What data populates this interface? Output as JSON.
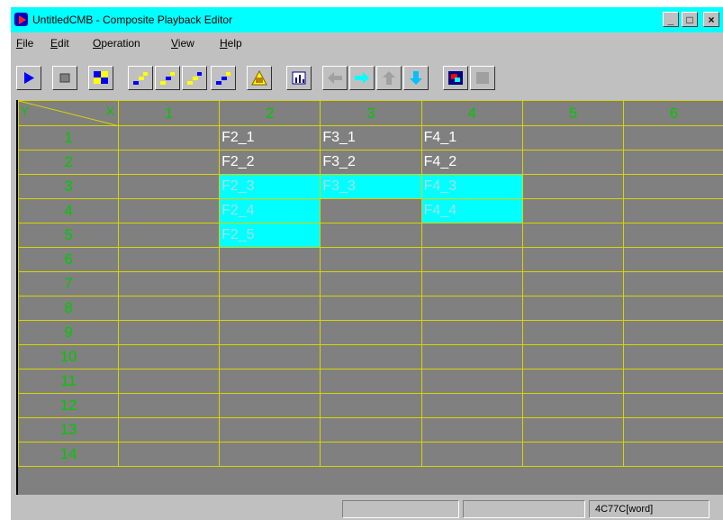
{
  "window": {
    "title": "UntitledCMB - Composite Playback Editor",
    "controls": {
      "minimize": "_",
      "maximize": "□",
      "close": "×"
    }
  },
  "menu": [
    {
      "label": "File",
      "key": "F"
    },
    {
      "label": "Edit",
      "key": "E"
    },
    {
      "label": "Operation",
      "key": "O"
    },
    {
      "label": "View",
      "key": "V"
    },
    {
      "label": "Help",
      "key": "H"
    }
  ],
  "toolbar": {
    "buttons": [
      {
        "name": "play-icon"
      },
      {
        "name": "stop-icon"
      },
      {
        "name": "frames-icon"
      },
      {
        "name": "step-icon-1"
      },
      {
        "name": "step-icon-2"
      },
      {
        "name": "step-icon-3"
      },
      {
        "name": "step-icon-4"
      },
      {
        "name": "warning-icon"
      },
      {
        "name": "chart-icon"
      },
      {
        "name": "arrow-left-icon"
      },
      {
        "name": "arrow-right-icon"
      },
      {
        "name": "arrow-up-icon"
      },
      {
        "name": "arrow-down-icon"
      },
      {
        "name": "color-icon"
      },
      {
        "name": "blank-icon"
      }
    ],
    "colors": {
      "blue": "#0000ff",
      "cyan": "#00ffff",
      "yellow": "#ffff00",
      "navy": "#000080",
      "red": "#ff0000"
    }
  },
  "grid": {
    "corner": {
      "y": "Y",
      "x": "X"
    },
    "columns": [
      "1",
      "2",
      "3",
      "4",
      "5",
      "6"
    ],
    "rows": [
      {
        "label": "1",
        "cells": [
          "",
          "F2_1",
          "F3_1",
          "F4_1",
          "",
          ""
        ],
        "highlight": [
          false,
          false,
          false,
          false,
          false,
          false
        ]
      },
      {
        "label": "2",
        "cells": [
          "",
          "F2_2",
          "F3_2",
          "F4_2",
          "",
          ""
        ],
        "highlight": [
          false,
          false,
          false,
          false,
          false,
          false
        ]
      },
      {
        "label": "3",
        "cells": [
          "",
          "F2_3",
          "F3_3",
          "F4_3",
          "",
          ""
        ],
        "highlight": [
          false,
          true,
          true,
          true,
          false,
          false
        ]
      },
      {
        "label": "4",
        "cells": [
          "",
          "F2_4",
          "",
          "F4_4",
          "",
          ""
        ],
        "highlight": [
          false,
          true,
          false,
          true,
          false,
          false
        ]
      },
      {
        "label": "5",
        "cells": [
          "",
          "F2_5",
          "",
          "",
          "",
          ""
        ],
        "highlight": [
          false,
          true,
          false,
          false,
          false,
          false
        ]
      },
      {
        "label": "6",
        "cells": [
          "",
          "",
          "",
          "",
          "",
          ""
        ],
        "highlight": [
          false,
          false,
          false,
          false,
          false,
          false
        ]
      },
      {
        "label": "7",
        "cells": [
          "",
          "",
          "",
          "",
          "",
          ""
        ],
        "highlight": [
          false,
          false,
          false,
          false,
          false,
          false
        ]
      },
      {
        "label": "8",
        "cells": [
          "",
          "",
          "",
          "",
          "",
          ""
        ],
        "highlight": [
          false,
          false,
          false,
          false,
          false,
          false
        ]
      },
      {
        "label": "9",
        "cells": [
          "",
          "",
          "",
          "",
          "",
          ""
        ],
        "highlight": [
          false,
          false,
          false,
          false,
          false,
          false
        ]
      },
      {
        "label": "10",
        "cells": [
          "",
          "",
          "",
          "",
          "",
          ""
        ],
        "highlight": [
          false,
          false,
          false,
          false,
          false,
          false
        ]
      },
      {
        "label": "11",
        "cells": [
          "",
          "",
          "",
          "",
          "",
          ""
        ],
        "highlight": [
          false,
          false,
          false,
          false,
          false,
          false
        ]
      },
      {
        "label": "12",
        "cells": [
          "",
          "",
          "",
          "",
          "",
          ""
        ],
        "highlight": [
          false,
          false,
          false,
          false,
          false,
          false
        ]
      },
      {
        "label": "13",
        "cells": [
          "",
          "",
          "",
          "",
          "",
          ""
        ],
        "highlight": [
          false,
          false,
          false,
          false,
          false,
          false
        ]
      },
      {
        "label": "14",
        "cells": [
          "",
          "",
          "",
          "",
          "",
          ""
        ],
        "highlight": [
          false,
          false,
          false,
          false,
          false,
          false
        ]
      }
    ],
    "colors": {
      "background": "#808080",
      "lines": "#d6d600",
      "highlight": "#00ffff",
      "labels": "#00c800"
    }
  },
  "status": {
    "panel1": "",
    "panel2": "",
    "panel3": "4C77C[word]"
  }
}
